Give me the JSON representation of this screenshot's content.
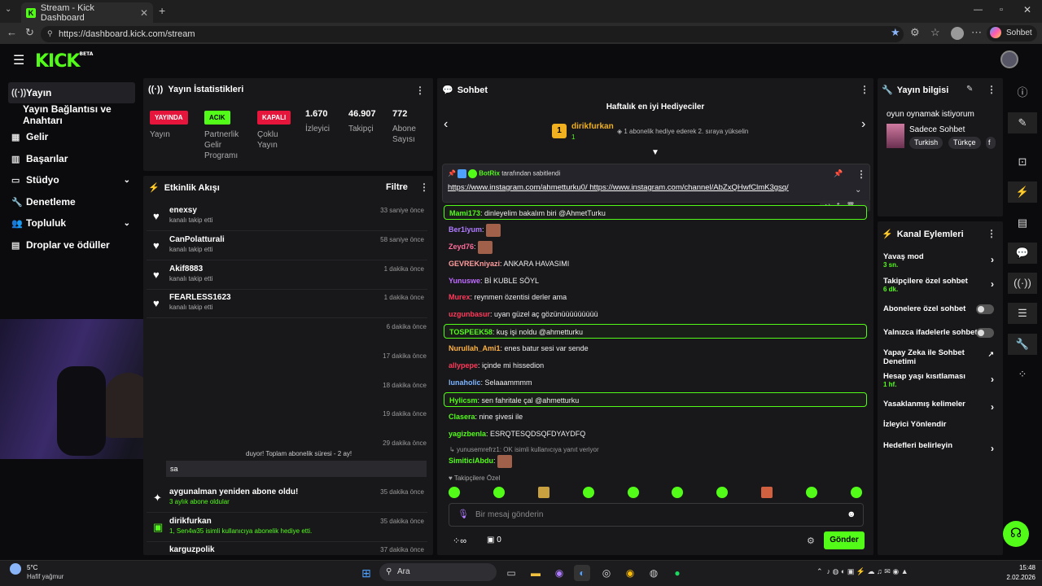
{
  "browser": {
    "tab_title": "Stream - Kick Dashboard",
    "url": "https://dashboard.kick.com/stream",
    "chat_button": "Sohbet et"
  },
  "app": {
    "logo": "KICK",
    "beta": "BETA"
  },
  "sidebar": {
    "items": [
      {
        "label": "Yayın"
      },
      {
        "label": "Yayın Bağlantısı ve Anahtarı"
      },
      {
        "label": "Gelir"
      },
      {
        "label": "Başarılar"
      },
      {
        "label": "Stüdyo"
      },
      {
        "label": "Denetleme"
      },
      {
        "label": "Topluluk"
      },
      {
        "label": "Droplar ve ödüller"
      }
    ]
  },
  "stats": {
    "title": "Yayın İstatistikleri",
    "badges": [
      {
        "text": "YAYINDA",
        "label": "Yayın"
      },
      {
        "text": "ACIK",
        "label": "Partnerlik Gelir Programı"
      },
      {
        "text": "KAPALI",
        "label": "Çoklu Yayın"
      }
    ],
    "values": [
      {
        "value": "1.670",
        "label": "İzleyici"
      },
      {
        "value": "46.907",
        "label": "Takipçi"
      },
      {
        "value": "772",
        "label": "Abone Sayısı"
      }
    ]
  },
  "activity": {
    "title": "Etkinlik Akışı",
    "filter": "Filtre",
    "items": [
      {
        "name": "enexsy",
        "sub": "kanalı takip etti",
        "time": "33 saniye önce"
      },
      {
        "name": "CanPolatturali",
        "sub": "kanalı takip etti",
        "time": "58 saniye önce"
      },
      {
        "name": "Akif8883",
        "sub": "kanalı takip etti",
        "time": "1 dakika önce"
      },
      {
        "name": "FEARLESS1623",
        "sub": "kanalı takip etti",
        "time": "1 dakika önce"
      }
    ],
    "times": [
      "6 dakika önce",
      "17 dakika önce",
      "18 dakika önce",
      "19 dakika önce",
      "29 dakika önce"
    ],
    "partial_text": "duyor! Toplam abonelik süresi - 2 ay!",
    "sa": "sa",
    "resub": {
      "name": "aygunalman yeniden abone oldu!",
      "sub": "3 aylık abone oldular",
      "time": "35 dakika önce"
    },
    "gift": {
      "name": "dirikfurkan",
      "sub": "1, Sen4w35 isimli kullanıcıya abonelik hediye etti.",
      "time": "35 dakika önce"
    },
    "last": {
      "name": "karguzpolik",
      "time": "37 dakika önce"
    }
  },
  "chat": {
    "title": "Sohbet",
    "top_gifters": "Haftalık en iyi Hediyeciler",
    "gifter": {
      "rank": "1",
      "name": "dirikfurkan",
      "count": "1",
      "note": "1 abonelik hediye ederek 2. sıraya yükselin"
    },
    "pinned_by": "BotRix",
    "pinned_suffix": "tarafından sabitlendi",
    "pinned_text": "https://www.instagram.com/ahmetturku0/ https://www.instagram.com/channel/AbZxQHwfClmK3gsq/",
    "messages": [
      {
        "user": "Mami173",
        "text": "dinleyelim bakalım biri @AhmetTurku",
        "color": "#53fc18",
        "hl": true
      },
      {
        "user": "Ber1iyum",
        "text": "",
        "color": "#b07cff",
        "emote": true
      },
      {
        "user": "Zeyd76",
        "text": "",
        "color": "#ff6b9a",
        "emote": true
      },
      {
        "user": "GEVREKniyazi",
        "text": "ANKARA HAVASIMI",
        "color": "#ff9c9c"
      },
      {
        "user": "Yunuswe",
        "text": "Bİ KUBLE SÖYL",
        "color": "#c06cff"
      },
      {
        "user": "Murex",
        "text": "reynmen özentisi derler ama",
        "color": "#ff3a5a"
      },
      {
        "user": "uzgunbasur",
        "text": "uyan güzel aç gözünüüüüüüüüü",
        "color": "#ff3a5a"
      },
      {
        "user": "TOSPEEK58",
        "text": "kuş işi noldu @ahmetturku",
        "color": "#53fc18",
        "hl": true
      },
      {
        "user": "Nurullah_Ami1",
        "text": "enes batur sesi var sende",
        "color": "#ffb340"
      },
      {
        "user": "allypepe",
        "text": "içinde mi hissedion",
        "color": "#ff3a5a"
      },
      {
        "user": "lunaholic",
        "text": "Selaaammmm",
        "color": "#7cb4ff"
      },
      {
        "user": "Hylicsm",
        "text": "sen fahritale çal @ahmetturku",
        "color": "#53fc18",
        "hl": true
      },
      {
        "user": "Clasera",
        "text": "nine şivesi ile",
        "color": "#53fc18"
      },
      {
        "user": "yagizbenla",
        "text": "ESRQTESQDSQFDYAYDFQ",
        "color": "#53fc18"
      },
      {
        "user": "SimiticiAbdu",
        "text": "",
        "color": "#53fc18",
        "emote": true
      }
    ],
    "reply_note": "yunusemrefrz1: OK isimli kullanıcıya yanıt veriyor",
    "followers_only": "Takipçilere Özel",
    "input_placeholder": "Bir mesaj gönderin",
    "count": "0",
    "send": "Gönder"
  },
  "info": {
    "title": "Yayın bilgisi",
    "stream_title": "oyun oynamak istiyorum",
    "category": "Sadece Sohbet",
    "tags": [
      "Turkish",
      "Türkçe",
      "f"
    ]
  },
  "actions": {
    "title": "Kanal Eylemleri",
    "items": [
      {
        "label": "Yavaş mod",
        "sub": "3 sn.",
        "type": "chev"
      },
      {
        "label": "Takipçilere özel sohbet",
        "sub": "6 dk.",
        "type": "chev"
      },
      {
        "label": "Abonelere özel sohbet",
        "type": "toggle"
      },
      {
        "label": "Yalnızca ifadelerle sohbet",
        "type": "toggle"
      },
      {
        "label": "Yapay Zeka ile Sohbet Denetimi",
        "type": "ext"
      },
      {
        "label": "Hesap yaşı kısıtlaması",
        "sub": "1 hf.",
        "type": "chev"
      },
      {
        "label": "Yasaklanmış kelimeler",
        "type": "chev"
      },
      {
        "label": "İzleyici Yönlendir",
        "type": "none"
      },
      {
        "label": "Hedefleri belirleyin",
        "type": "chev"
      }
    ]
  },
  "taskbar": {
    "weather_temp": "5°C",
    "weather_desc": "Hafif yağmur",
    "search": "Ara",
    "time": "15:48",
    "date": "2.02.2026"
  },
  "colors": {
    "accent": "#53fc18",
    "panel": "#18181b",
    "live": "#e5153b"
  }
}
